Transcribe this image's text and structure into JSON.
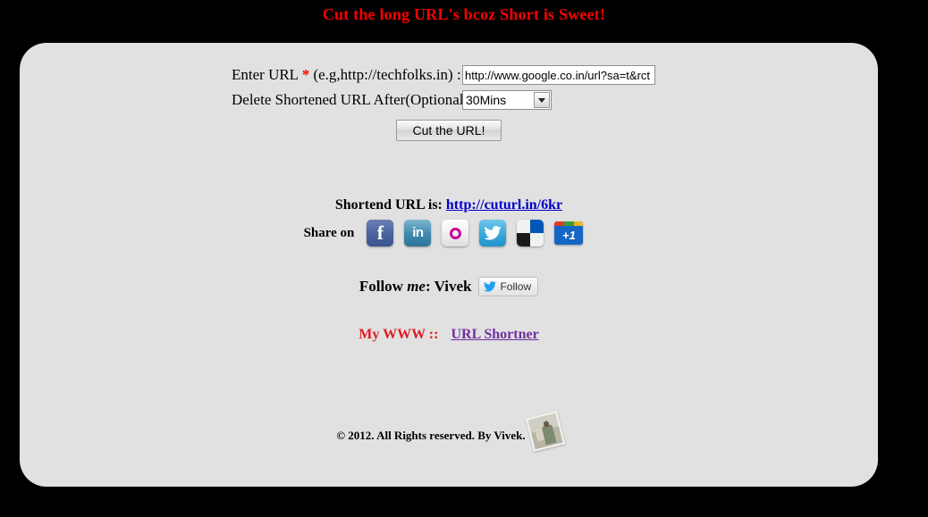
{
  "page": {
    "title": "Cut the long URL's bcoz Short is Sweet!",
    "title_color": "#ff0000",
    "background_color": "#000000",
    "panel_color": "#e1e1e1"
  },
  "form": {
    "url_label_main": "Enter URL",
    "url_label_star": "*",
    "url_label_hint": "(e.g,http://techfolks.in) :",
    "url_value": "http://www.google.co.in/url?sa=t&rct",
    "url_placeholder": "http://techfolks.in",
    "ttl_label": "Delete Shortened URL After(Optional) :",
    "ttl_selected": "30Mins",
    "ttl_options": [
      "30Mins"
    ],
    "submit_label": "Cut the URL!"
  },
  "result": {
    "prefix": "Shortend URL is:",
    "link_text": "http://cuturl.in/6kr",
    "link_color": "#0000cc"
  },
  "share": {
    "label": "Share on",
    "icons": [
      {
        "name": "facebook-icon",
        "glyph": "f",
        "title": "Facebook"
      },
      {
        "name": "linkedin-icon",
        "glyph": "in",
        "title": "LinkedIn"
      },
      {
        "name": "orkut-icon",
        "glyph": "O",
        "title": "Orkut"
      },
      {
        "name": "twitter-icon",
        "glyph": "bird",
        "title": "Twitter"
      },
      {
        "name": "delicious-icon",
        "glyph": "checker",
        "title": "Delicious"
      },
      {
        "name": "google-plus-one-icon",
        "glyph": "+1",
        "title": "Google +1"
      }
    ],
    "plus_one_label": "+1"
  },
  "follow": {
    "prefix": "Follow",
    "emphasis": "me",
    "suffix": ": Vivek",
    "button_label": "Follow"
  },
  "www": {
    "label": "My WWW ::",
    "label_color": "#e01b24",
    "link_text": "URL Shortner",
    "link_color": "#7030a0"
  },
  "footer": {
    "text": "© 2012. All Rights reserved. By Vivek."
  }
}
